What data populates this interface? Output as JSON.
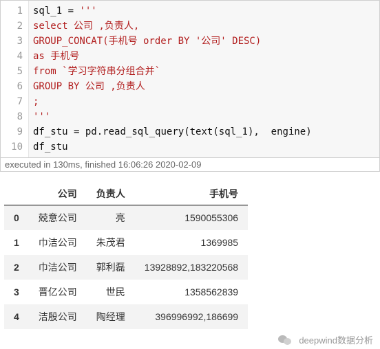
{
  "code": {
    "lines": [
      {
        "no": "1",
        "tokens": [
          {
            "cls": "id",
            "t": "sql_1"
          },
          {
            "cls": "punc",
            "t": " = "
          },
          {
            "cls": "str",
            "t": "'''"
          }
        ]
      },
      {
        "no": "2",
        "tokens": [
          {
            "cls": "str",
            "t": "select 公司 ,负责人,"
          }
        ]
      },
      {
        "no": "3",
        "tokens": [
          {
            "cls": "str",
            "t": "GROUP_CONCAT(手机号 order BY '公司' DESC)"
          }
        ]
      },
      {
        "no": "4",
        "tokens": [
          {
            "cls": "str",
            "t": "as 手机号"
          }
        ]
      },
      {
        "no": "5",
        "tokens": [
          {
            "cls": "str",
            "t": "from `学习字符串分组合并`"
          }
        ]
      },
      {
        "no": "6",
        "tokens": [
          {
            "cls": "str",
            "t": "GROUP BY 公司 ,负责人"
          }
        ]
      },
      {
        "no": "7",
        "tokens": [
          {
            "cls": "str",
            "t": ";"
          }
        ]
      },
      {
        "no": "8",
        "tokens": [
          {
            "cls": "str",
            "t": "'''"
          }
        ]
      },
      {
        "no": "9",
        "tokens": [
          {
            "cls": "id",
            "t": "df_stu"
          },
          {
            "cls": "punc",
            "t": " = "
          },
          {
            "cls": "id",
            "t": "pd"
          },
          {
            "cls": "punc",
            "t": "."
          },
          {
            "cls": "id",
            "t": "read_sql_query"
          },
          {
            "cls": "punc",
            "t": "("
          },
          {
            "cls": "id",
            "t": "text"
          },
          {
            "cls": "punc",
            "t": "("
          },
          {
            "cls": "id",
            "t": "sql_1"
          },
          {
            "cls": "punc",
            "t": "),  "
          },
          {
            "cls": "id",
            "t": "engine"
          },
          {
            "cls": "punc",
            "t": ")"
          }
        ]
      },
      {
        "no": "10",
        "tokens": [
          {
            "cls": "id",
            "t": "df_stu"
          }
        ]
      }
    ]
  },
  "status_text": "executed in 130ms, finished 16:06:26 2020-02-09",
  "chart_data": {
    "type": "table",
    "columns": [
      "公司",
      "负责人",
      "手机号"
    ],
    "index": [
      "0",
      "1",
      "2",
      "3",
      "4"
    ],
    "rows": [
      [
        "兢意公司",
        "亮",
        "1590055306"
      ],
      [
        "巾洁公司",
        "朱茂君",
        "1369985"
      ],
      [
        "巾洁公司",
        "郭利磊",
        "13928892,183220568"
      ],
      [
        "晋亿公司",
        "世民",
        "1358562839"
      ],
      [
        "洁殷公司",
        "陶经理",
        "396996992,186699"
      ]
    ]
  },
  "footer": {
    "brand": "deepwind数据分析"
  }
}
